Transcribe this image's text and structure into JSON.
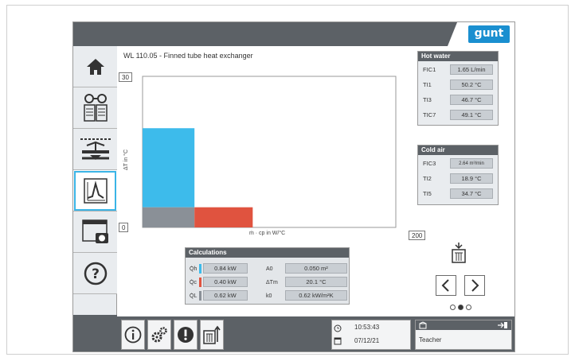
{
  "brand": {
    "logo_text": "gunt"
  },
  "page": {
    "title": "WL 110.05 - Finned tube heat exchanger"
  },
  "sidebar": {
    "items": [
      {
        "icon": "home-icon"
      },
      {
        "icon": "book-glasses-icon"
      },
      {
        "icon": "process-schematic-icon"
      },
      {
        "icon": "diagram-icon",
        "active": true
      },
      {
        "icon": "screenshot-camera-icon"
      },
      {
        "icon": "help-icon"
      }
    ]
  },
  "chart_data": {
    "type": "bar",
    "xlabel": "ṁ · cp in W/°C",
    "ylabel": "ΔT in °C",
    "xlim": [
      0,
      200
    ],
    "ylim": [
      0,
      30
    ],
    "x_min_label": "0",
    "x_max_label": "200",
    "y_max_label": "30",
    "bars": [
      {
        "name": "Hot water",
        "x_start": 0,
        "x_end": 41,
        "y_start": 4,
        "y_end": 19.7,
        "color": "#3dbbeb"
      },
      {
        "name": "Hot water base",
        "x_start": 0,
        "x_end": 41,
        "y_start": 0,
        "y_end": 4,
        "color": "#8a9097"
      },
      {
        "name": "Cold air",
        "x_start": 41,
        "x_end": 87,
        "y_start": 0,
        "y_end": 4,
        "color": "#e0533f"
      }
    ]
  },
  "calculations": {
    "title": "Calculations",
    "left": [
      {
        "label": "Q̇h",
        "value": "0.84 kW",
        "color": "#3dbbeb"
      },
      {
        "label": "Q̇c",
        "value": "0.40 kW",
        "color": "#e0533f"
      },
      {
        "label": "Q̇L",
        "value": "0.62 kW",
        "color": "#8a9097"
      }
    ],
    "right": [
      {
        "label": "A0",
        "value": "0.050 m²"
      },
      {
        "label": "ΔTm",
        "value": "20.1 °C"
      },
      {
        "label": "k0",
        "value": "0.62 kW/m²K"
      }
    ]
  },
  "hot_water": {
    "title": "Hot water",
    "rows": [
      {
        "tag": "FIC1",
        "value": "1.65 L/min"
      },
      {
        "tag": "TI1",
        "value": "50.2 °C"
      },
      {
        "tag": "TI3",
        "value": "46.7 °C"
      },
      {
        "tag": "TIC7",
        "value": "49.1 °C"
      }
    ]
  },
  "cold_air": {
    "title": "Cold air",
    "rows": [
      {
        "tag": "FIC3",
        "value": "2.64 m³/min"
      },
      {
        "tag": "TI2",
        "value": "18.9 °C"
      },
      {
        "tag": "TI5",
        "value": "34.7 °C"
      }
    ]
  },
  "nav": {
    "page_count": 3,
    "current_page": 2
  },
  "status": {
    "time": "10:53:43",
    "date": "07/12/21",
    "user": "Teacher"
  }
}
